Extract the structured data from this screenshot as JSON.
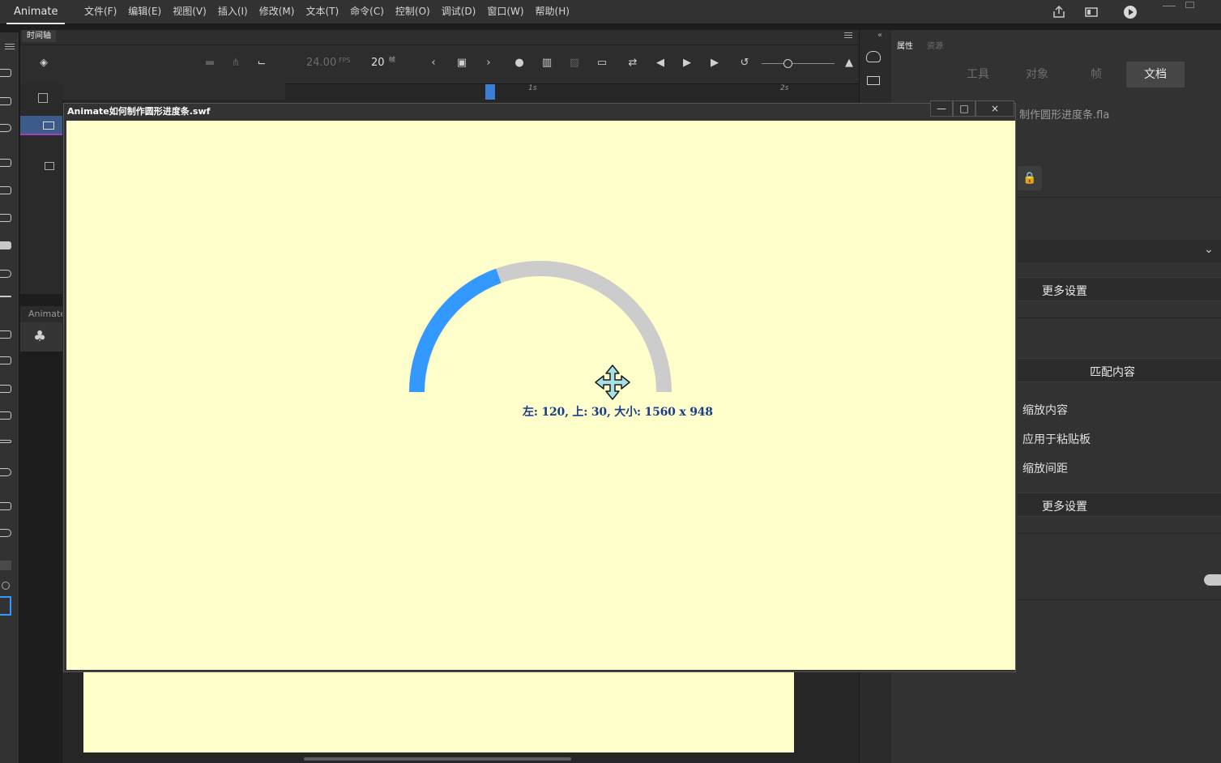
{
  "app": {
    "name": "Animate",
    "menu": [
      "文件(F)",
      "编辑(E)",
      "视图(V)",
      "插入(I)",
      "修改(M)",
      "文本(T)",
      "命令(C)",
      "控制(O)",
      "调试(D)",
      "窗口(W)",
      "帮助(H)"
    ]
  },
  "timeline": {
    "tab_label": "时间轴",
    "fps": "24.00",
    "fps_unit": "FPS",
    "frame": "20",
    "frame_unit": "帧",
    "ruler_marks": [
      "1s",
      "2s"
    ]
  },
  "library": {
    "header": "Animate"
  },
  "swf_window": {
    "title": "Animate如何制作圆形进度条.swf",
    "minimize": "—",
    "maximize": "□",
    "close": "×",
    "coords_text": "左: 120, 上: 30, 大小: 1560 x 948",
    "progress": {
      "fraction": 0.39,
      "fill_color": "#3399ff",
      "track_color": "#cccccc",
      "shape": "semicircle"
    }
  },
  "properties": {
    "tabs": [
      "属性",
      "资源"
    ],
    "subtabs": [
      "工具",
      "对象",
      "帧",
      "文档"
    ],
    "active_subtab": "文档",
    "file_name": "制作圆形进度条.fla",
    "more_settings_1": "更多设置",
    "match_content": "匹配内容",
    "options": [
      "缩放内容",
      "应用于粘贴板",
      "缩放间距"
    ],
    "more_settings_2": "更多设置"
  }
}
